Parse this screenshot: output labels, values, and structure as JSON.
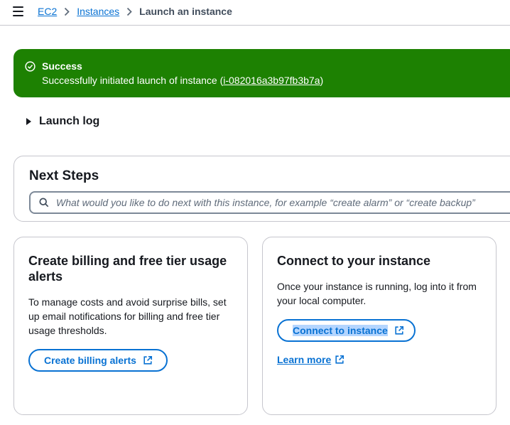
{
  "breadcrumb": {
    "items": [
      "EC2",
      "Instances"
    ],
    "current": "Launch an instance"
  },
  "flash": {
    "title": "Success",
    "message_prefix": "Successfully initiated launch of instance (",
    "instance_id": "i-082016a3b97fb3b7a",
    "message_suffix": ")",
    "color": "#1d8102"
  },
  "launch_log": {
    "label": "Launch log"
  },
  "next_steps": {
    "title": "Next Steps",
    "search_placeholder": "What would you like to do next with this instance, for example “create alarm” or “create backup”"
  },
  "cards": {
    "billing": {
      "title": "Create billing and free tier usage alerts",
      "body": "To manage costs and avoid surprise bills, set up email notifications for billing and free tier usage thresholds.",
      "button_label": "Create billing alerts"
    },
    "connect": {
      "title": "Connect to your instance",
      "body": "Once your instance is running, log into it from your local computer.",
      "button_label": "Connect to instance",
      "learn_more_label": "Learn more"
    }
  },
  "colors": {
    "link": "#0972d3",
    "success": "#1d8102",
    "border": "#c6c6cd"
  }
}
